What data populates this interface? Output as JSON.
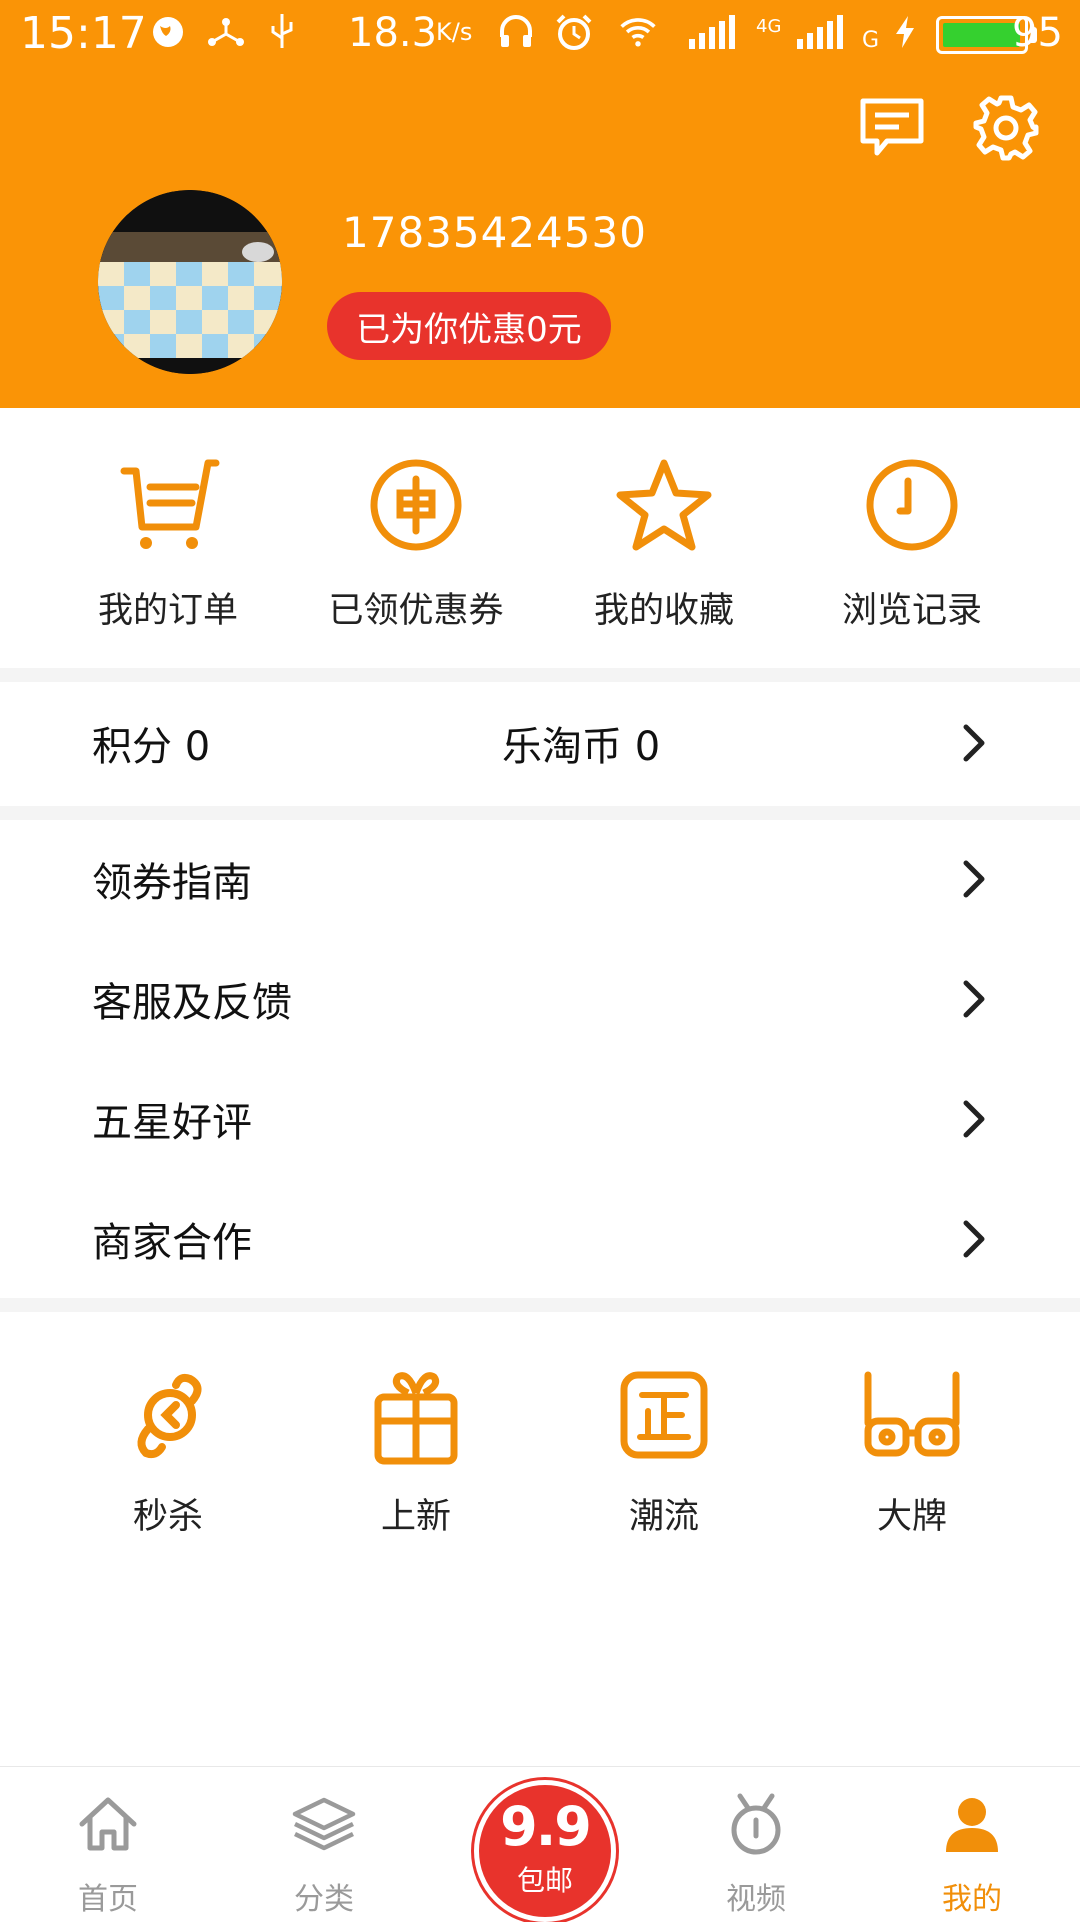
{
  "status_bar": {
    "time": "15:17",
    "speed": "18.3",
    "speed_unit": "K/s",
    "signal_1": "4G",
    "signal_2": "G",
    "battery": "95"
  },
  "header": {
    "phone": "17835424530",
    "discount": "已为你优惠0元"
  },
  "quick_actions": [
    {
      "label": "我的订单",
      "icon": "cart-icon"
    },
    {
      "label": "已领优惠券",
      "icon": "coupon-coin-icon"
    },
    {
      "label": "我的收藏",
      "icon": "star-icon"
    },
    {
      "label": "浏览记录",
      "icon": "clock-icon"
    }
  ],
  "points": {
    "points_label": "积分 0",
    "coins_label": "乐淘币 0"
  },
  "menu": [
    {
      "label": "领券指南"
    },
    {
      "label": "客服及反馈"
    },
    {
      "label": "五星好评"
    },
    {
      "label": "商家合作"
    }
  ],
  "features": [
    {
      "label": "秒杀",
      "icon": "flash-sale-icon"
    },
    {
      "label": "上新",
      "icon": "gift-icon"
    },
    {
      "label": "潮流",
      "icon": "trend-tag-icon"
    },
    {
      "label": "大牌",
      "icon": "glasses-icon"
    }
  ],
  "bottom_nav": {
    "items": [
      {
        "label": "首页",
        "icon": "home-icon"
      },
      {
        "label": "分类",
        "icon": "layers-icon"
      },
      {
        "label": "视频",
        "icon": "tv-icon"
      },
      {
        "label": "我的",
        "icon": "user-icon",
        "active": true
      }
    ],
    "center": {
      "big": "9.9",
      "small": "包邮"
    }
  },
  "colors": {
    "brand_orange": "#FA9406",
    "icon_orange": "#F18F0A",
    "red": "#E8332C"
  }
}
